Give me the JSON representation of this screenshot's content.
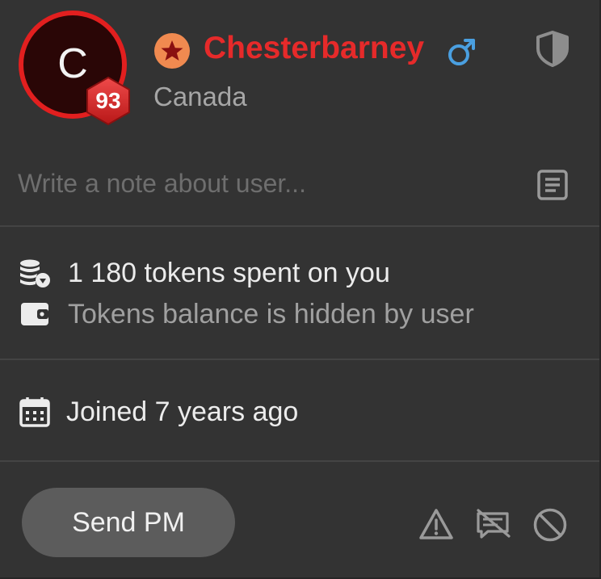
{
  "user": {
    "avatar_letter": "C",
    "level": "93",
    "name": "Chesterbarney",
    "country": "Canada",
    "rank_icon": "star-badge-icon",
    "gender_icon": "male-icon"
  },
  "note": {
    "placeholder": "Write a note about user...",
    "value": ""
  },
  "tokens": {
    "spent_text": "1 180 tokens spent on you",
    "balance_text": "Tokens balance is hidden by user"
  },
  "joined": {
    "text": "Joined 7 years ago"
  },
  "actions": {
    "send_pm_label": "Send PM",
    "icons": [
      "warning-icon",
      "chat-disabled-icon",
      "block-icon"
    ]
  },
  "colors": {
    "accent_red": "#e62a2a",
    "avatar_ring": "#e21f1f",
    "rank_orange": "#f08a50",
    "gender_blue": "#4a9fe0",
    "background": "#333333"
  }
}
